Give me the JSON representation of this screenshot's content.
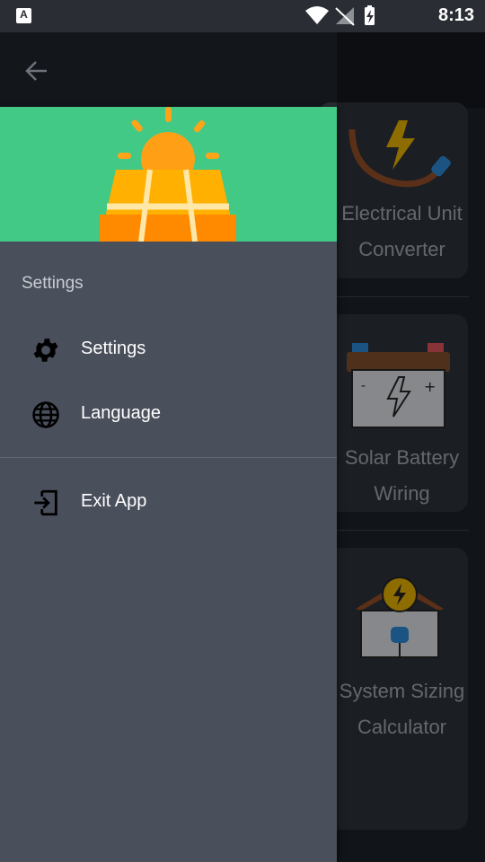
{
  "status_bar": {
    "app_badge": "A",
    "time": "8:13"
  },
  "toolbar": {
    "back_icon": "arrow-left-icon"
  },
  "background_cards": [
    {
      "title_line1": "Electrical Unit",
      "title_line2": "Converter",
      "icon": "power-plug-icon"
    },
    {
      "title_line1": "Solar Battery",
      "title_line2": "Wiring",
      "icon": "battery-icon"
    },
    {
      "title_line1": "System Sizing",
      "title_line2": "Calculator",
      "icon": "house-power-icon"
    }
  ],
  "drawer": {
    "header_icon": "solar-panel-sun-icon",
    "section_title": "Settings",
    "items": [
      {
        "label": "Settings",
        "icon": "gear-icon"
      },
      {
        "label": "Language",
        "icon": "globe-icon"
      },
      {
        "label": "Exit App",
        "icon": "exit-icon"
      }
    ]
  },
  "colors": {
    "drawer_header": "#43c986",
    "drawer_bg": "#4a4f5c",
    "sun": "#ffa319",
    "panel": "#ffb000"
  }
}
